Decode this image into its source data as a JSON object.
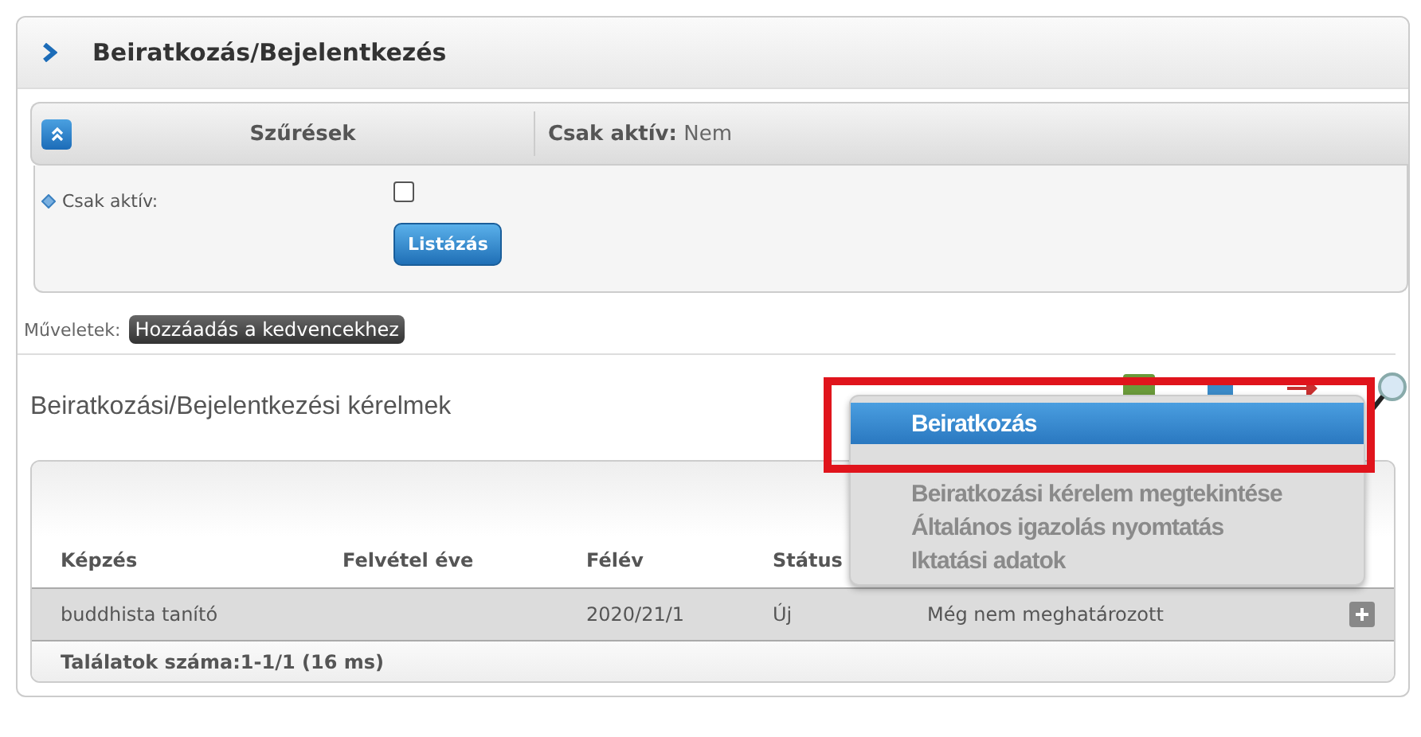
{
  "panel": {
    "title": "Beiratkozás/Bejelentkezés"
  },
  "filter_bar": {
    "title": "Szűrések",
    "expanded": true,
    "summary_label": "Csak aktív:",
    "summary_value": "Nem"
  },
  "filter": {
    "label": "Csak aktív:",
    "checked": false,
    "button": "Listázás"
  },
  "actions": {
    "label": "Műveletek:",
    "buttons": [
      "Hozzáadás a kedvencekhez"
    ]
  },
  "section": {
    "title": "Beiratkozási/Bejelentkezési kérelmek"
  },
  "table": {
    "columns": [
      "Képzés",
      "Felvétel éve",
      "Félév",
      "Státus"
    ],
    "rows": [
      {
        "cells": [
          "buddhista tanító",
          "",
          "2020/21/1",
          "Új",
          "Még nem meghatározott"
        ],
        "selected": true
      }
    ],
    "footer": "Találatok száma:1-1/1 (16 ms)"
  },
  "context_menu": {
    "items": [
      {
        "label": "Beiratkozás",
        "selected": true
      },
      {
        "label": "Beiratkozási kérelem megtekintése",
        "selected": false
      },
      {
        "label": "Általános igazolás nyomtatás",
        "selected": false
      },
      {
        "label": "Iktatási adatok",
        "selected": false
      }
    ]
  }
}
